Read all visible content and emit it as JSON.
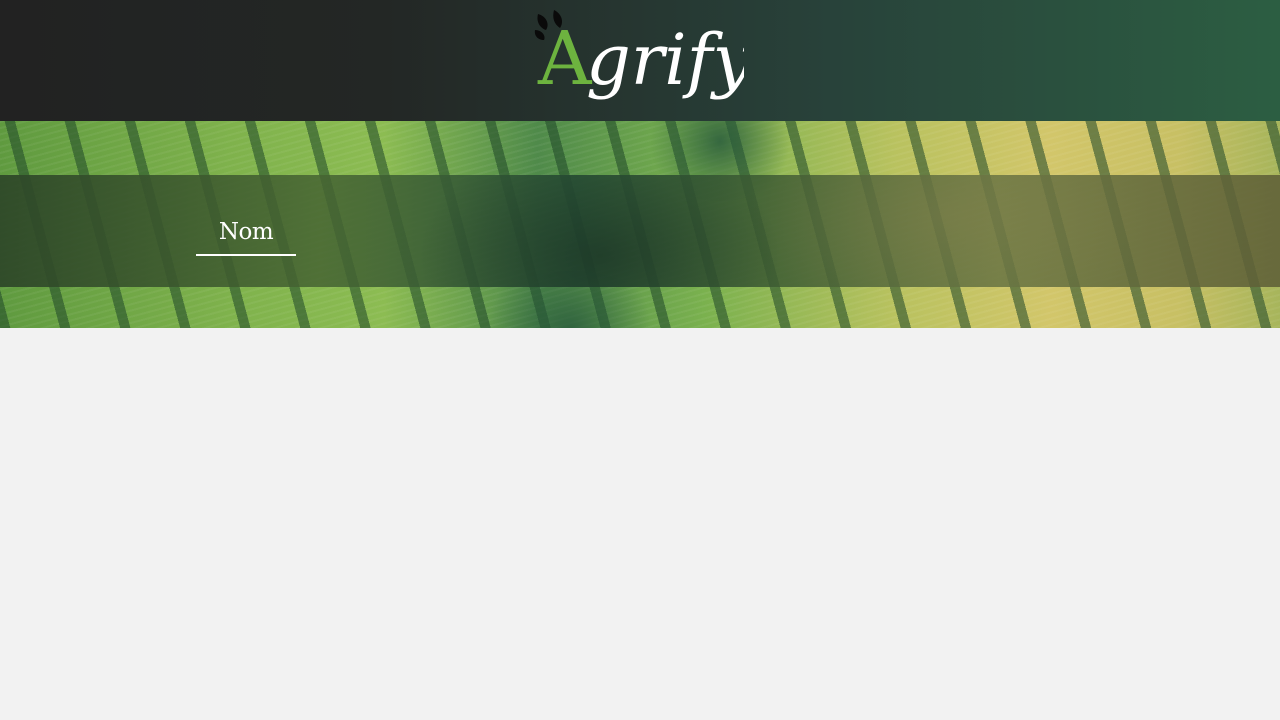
{
  "brand": {
    "name": "Agrify",
    "logo_initial": "A",
    "logo_rest": "grify",
    "colors": {
      "initial": "#6db33f",
      "rest": "#ffffff",
      "sprout": "#0a0a0a"
    }
  },
  "tabs": [
    {
      "label": "Nom",
      "active": true
    }
  ],
  "theme": {
    "header_dark": "#222222",
    "header_green": "#2c5e42",
    "page_background": "#f2f2f2"
  }
}
